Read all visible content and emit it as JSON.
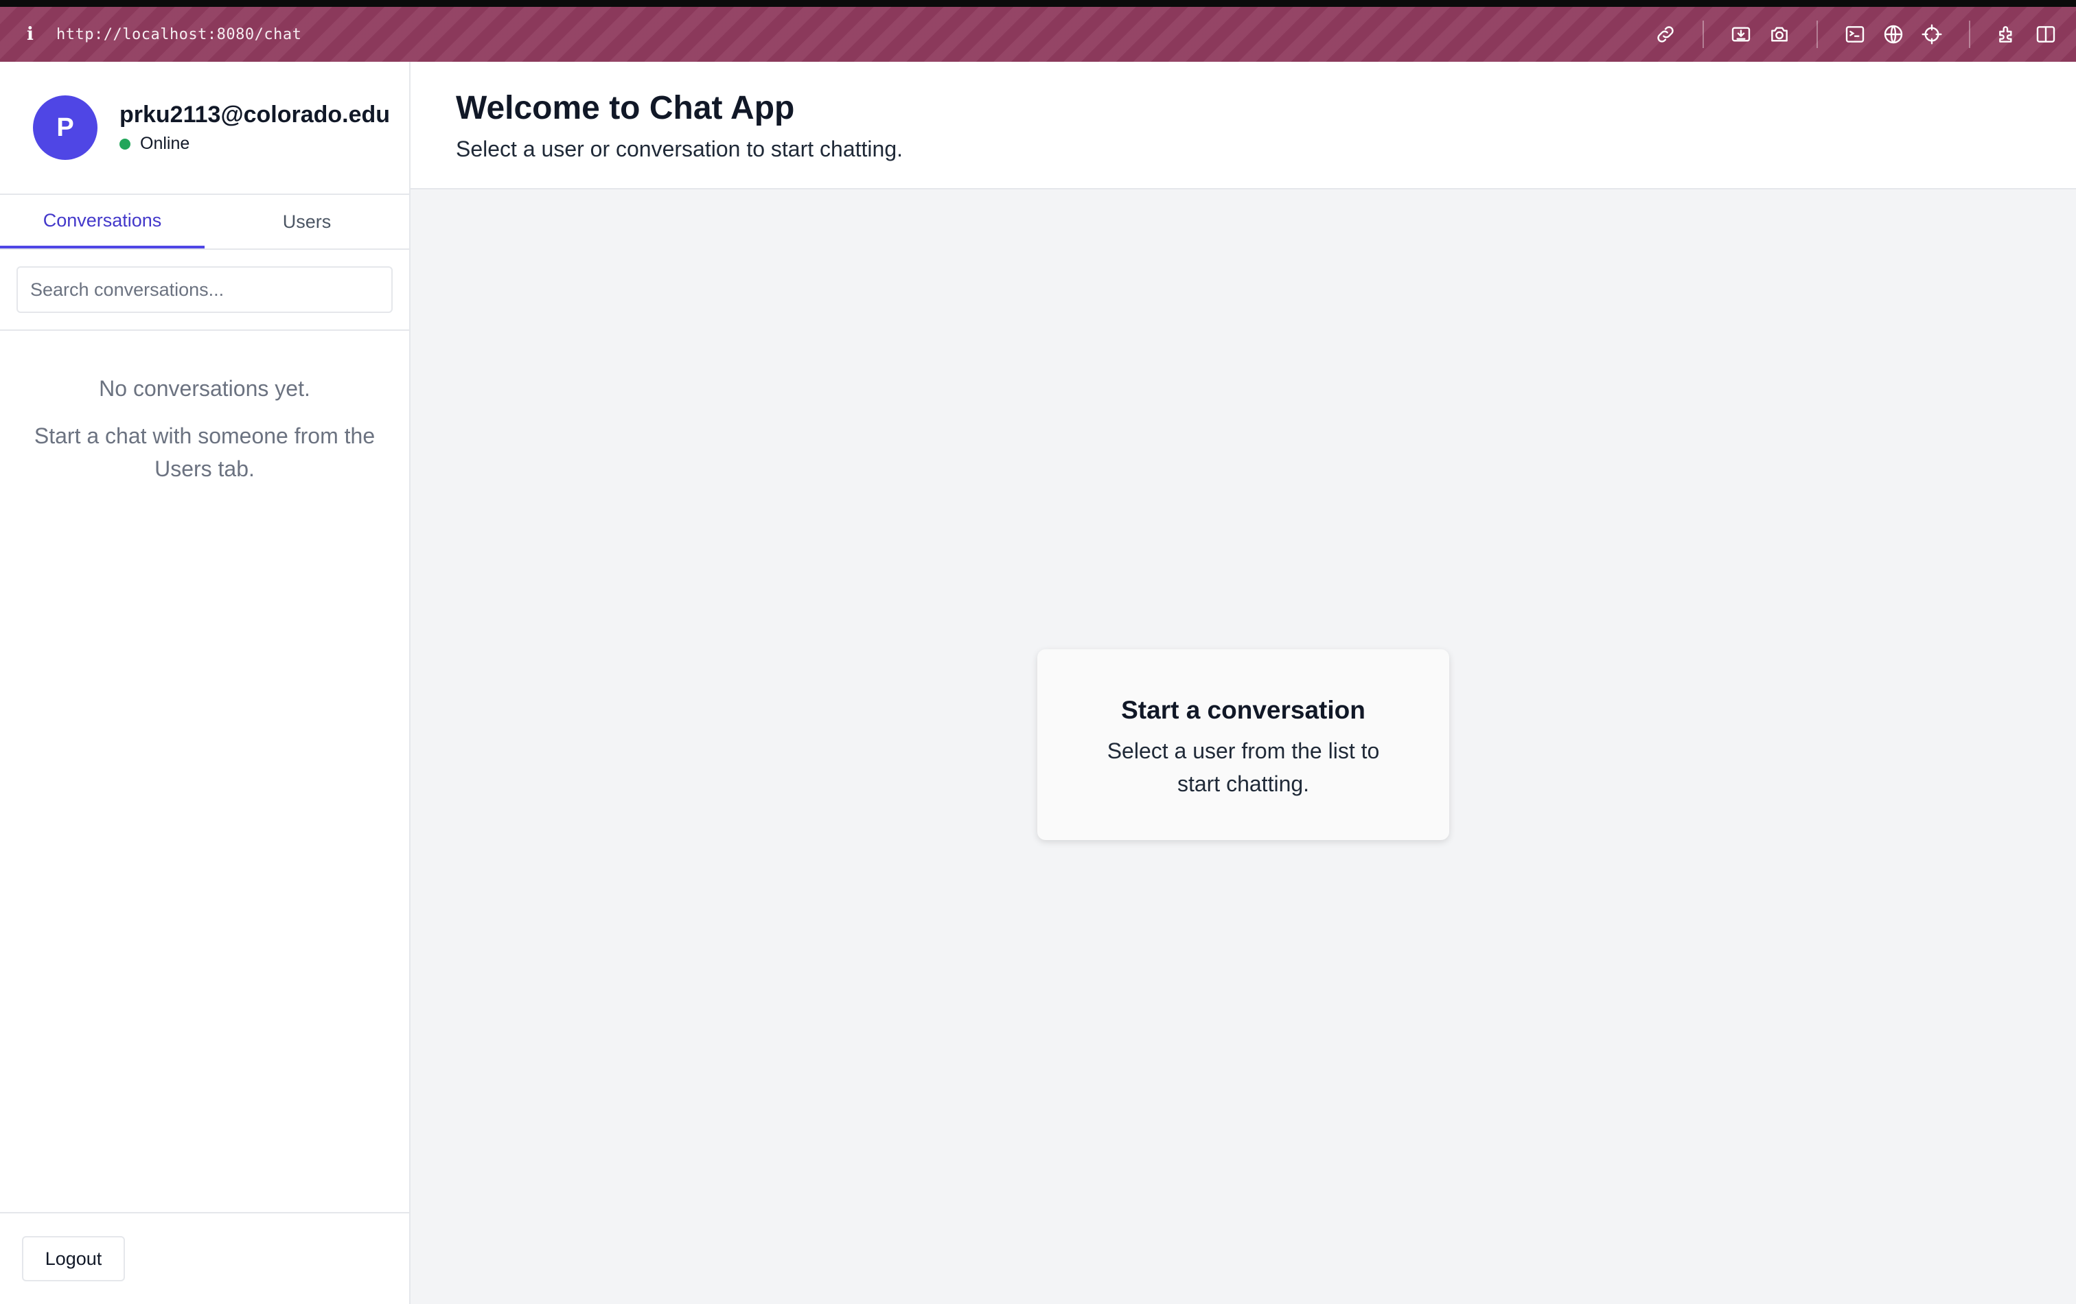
{
  "browser": {
    "url": "http://localhost:8080/chat",
    "info_icon": "info-icon",
    "toolbar_icons": [
      "link-icon",
      "download-icon",
      "camera-icon",
      "terminal-icon",
      "globe-icon",
      "crosshair-icon",
      "extension-icon",
      "sidebar-toggle-icon"
    ],
    "accent_color": "#8f3b5e"
  },
  "profile": {
    "avatar_initial": "P",
    "email": "prku2113@colorado.edu",
    "status": "Online",
    "status_color": "#22a65a",
    "avatar_color": "#4f46e5"
  },
  "tabs": [
    {
      "label": "Conversations",
      "active": true
    },
    {
      "label": "Users",
      "active": false
    }
  ],
  "search": {
    "placeholder": "Search conversations...",
    "value": ""
  },
  "empty_state": {
    "title": "No conversations yet.",
    "subtitle": "Start a chat with someone from the Users tab."
  },
  "footer": {
    "logout_label": "Logout"
  },
  "header": {
    "title": "Welcome to Chat App",
    "subtitle": "Select a user or conversation to start chatting."
  },
  "card": {
    "title": "Start a conversation",
    "subtitle": "Select a user from the list to start chatting."
  }
}
